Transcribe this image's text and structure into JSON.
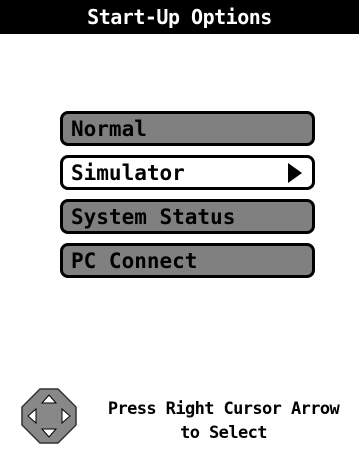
{
  "title": "Start-Up Options",
  "menu": {
    "items": [
      {
        "label": "Normal",
        "selected": false
      },
      {
        "label": "Simulator",
        "selected": true
      },
      {
        "label": "System Status",
        "selected": false
      },
      {
        "label": "PC Connect",
        "selected": false
      }
    ]
  },
  "hint": {
    "line1": "Press Right Cursor Arrow",
    "line2": "to Select"
  },
  "icons": {
    "dpad": "directional-pad-icon",
    "submenu": "right-arrow-icon"
  },
  "colors": {
    "titlebar_bg": "#000000",
    "titlebar_text": "#ffffff",
    "item_unselected_bg": "#808080",
    "item_selected_bg": "#ffffff"
  }
}
